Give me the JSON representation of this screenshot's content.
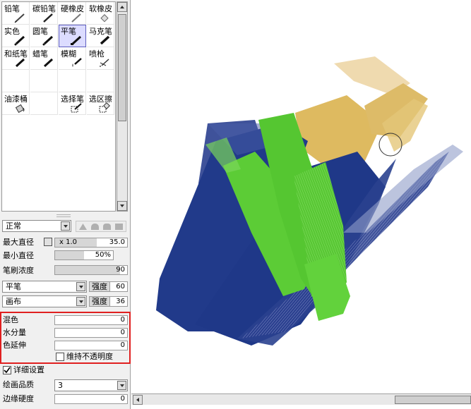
{
  "tools": [
    {
      "label": "铅笔"
    },
    {
      "label": "碳铅笔"
    },
    {
      "label": "硬橡皮"
    },
    {
      "label": "软橡皮"
    },
    {
      "label": "实色"
    },
    {
      "label": "圆笔"
    },
    {
      "label": "平笔",
      "selected": true
    },
    {
      "label": "马克笔"
    },
    {
      "label": "和纸笔"
    },
    {
      "label": "蜡笔"
    },
    {
      "label": "模糊"
    },
    {
      "label": "喷枪"
    },
    {
      "label": ""
    },
    {
      "label": ""
    },
    {
      "label": ""
    },
    {
      "label": ""
    },
    {
      "label": "油漆桶"
    },
    {
      "label": ""
    },
    {
      "label": "选择笔"
    },
    {
      "label": "选区擦"
    }
  ],
  "blend_mode": "正常",
  "max_diameter": {
    "label": "最大直径",
    "multiplier": "x 1.0",
    "value": "35.0"
  },
  "min_diameter": {
    "label": "最小直径",
    "value": "50%"
  },
  "density": {
    "label": "笔刷浓度",
    "value": "90"
  },
  "brush_shape": {
    "value": "平笔",
    "strength_label": "强度",
    "strength": "60"
  },
  "texture": {
    "value": "画布",
    "strength_label": "强度",
    "strength": "36"
  },
  "blending": {
    "label": "混色",
    "value": "0"
  },
  "water": {
    "label": "水分量",
    "value": "0"
  },
  "color_stretch": {
    "label": "色延伸",
    "value": "0"
  },
  "keep_opacity": {
    "label": "维持不透明度",
    "checked": false
  },
  "advanced": {
    "label": "详细设置",
    "checked": true
  },
  "quality": {
    "label": "绘画品质",
    "value": "3"
  },
  "edge_hardness": {
    "label": "边缘硬度",
    "value": "0"
  },
  "colors": {
    "highlight": "#e02020",
    "selected_tool": "#dcdcff",
    "navy": "#1e3a8a",
    "green": "#55cc33",
    "ochre": "#d9b04a"
  }
}
